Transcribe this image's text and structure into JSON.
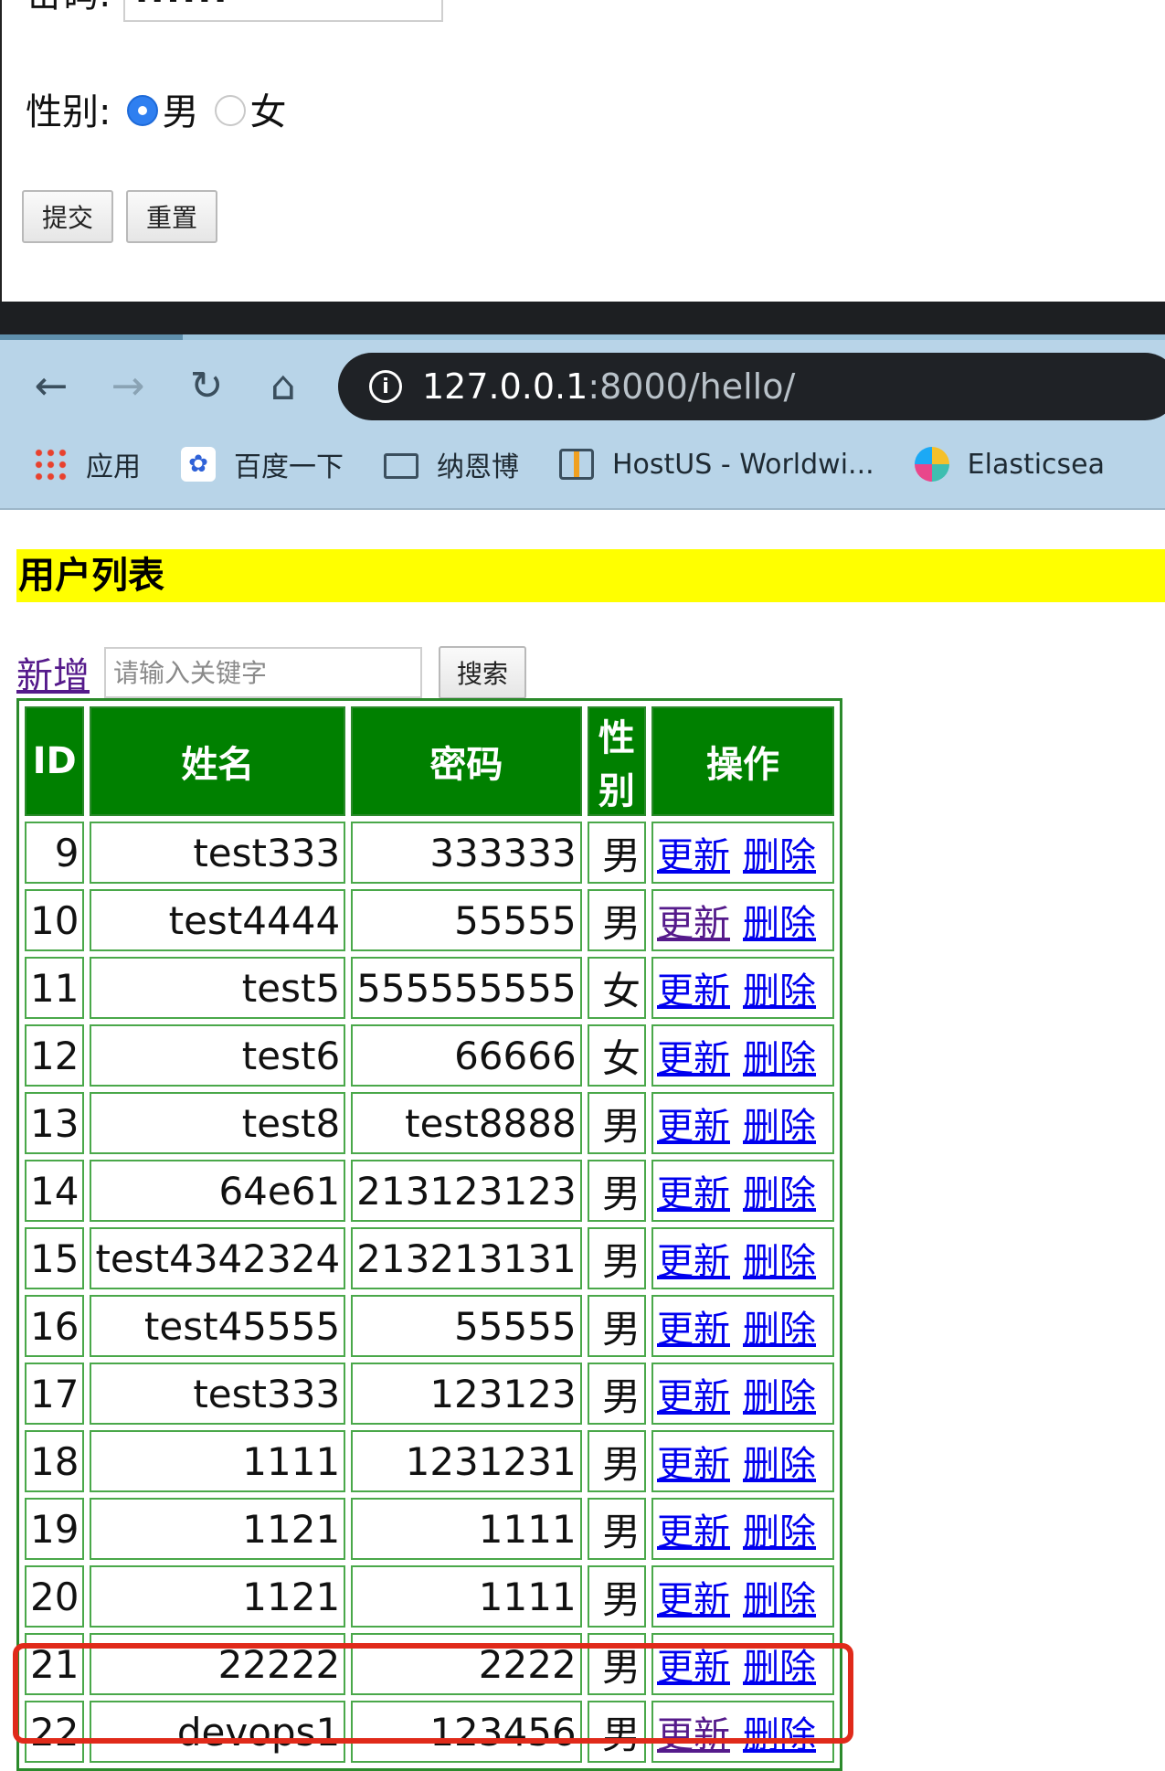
{
  "form": {
    "password_label": "密码:",
    "password_value": "......",
    "gender_label": "性别:",
    "gender_male": "男",
    "gender_female": "女",
    "submit_label": "提交",
    "reset_label": "重置"
  },
  "browser": {
    "url_host": "127.0.0.1",
    "url_rest": ":8000/hello/",
    "bookmarks": [
      "应用",
      "百度一下",
      "纳恩博",
      "HostUS - Worldwi...",
      "Elasticsea"
    ]
  },
  "page": {
    "title": "用户列表",
    "add_label": "新增",
    "search_placeholder": "请输入关键字",
    "search_button": "搜索"
  },
  "table": {
    "headers": [
      "ID",
      "姓名",
      "密码",
      "性别",
      "操作"
    ],
    "update_label": "更新",
    "delete_label": "删除",
    "rows": [
      {
        "id": "9",
        "name": "test333",
        "password": "333333",
        "gender": "男"
      },
      {
        "id": "10",
        "name": "test4444",
        "password": "55555",
        "gender": "男"
      },
      {
        "id": "11",
        "name": "test5",
        "password": "555555555",
        "gender": "女"
      },
      {
        "id": "12",
        "name": "test6",
        "password": "66666",
        "gender": "女"
      },
      {
        "id": "13",
        "name": "test8",
        "password": "test8888",
        "gender": "男"
      },
      {
        "id": "14",
        "name": "64e61",
        "password": "213123123",
        "gender": "男"
      },
      {
        "id": "15",
        "name": "test4342324",
        "password": "213213131",
        "gender": "男"
      },
      {
        "id": "16",
        "name": "test45555",
        "password": "55555",
        "gender": "男"
      },
      {
        "id": "17",
        "name": "test333",
        "password": "123123",
        "gender": "男"
      },
      {
        "id": "18",
        "name": "1111",
        "password": "1231231",
        "gender": "男"
      },
      {
        "id": "19",
        "name": "1121",
        "password": "1111",
        "gender": "男"
      },
      {
        "id": "20",
        "name": "1121",
        "password": "1111",
        "gender": "男"
      },
      {
        "id": "21",
        "name": "22222",
        "password": "2222",
        "gender": "男"
      },
      {
        "id": "22",
        "name": "devops1",
        "password": "123456",
        "gender": "男"
      }
    ]
  },
  "colors": {
    "title_bg": "#ffff00",
    "header_bg": "#008000",
    "highlight": "#e02a1a"
  }
}
